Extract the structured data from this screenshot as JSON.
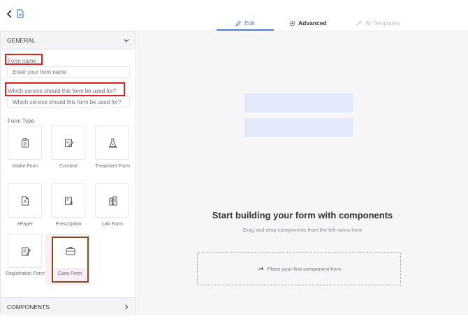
{
  "header": {
    "tabs": [
      {
        "label": "Edit",
        "icon": "pencil-icon",
        "active": true
      },
      {
        "label": "Advanced",
        "icon": "gear-icon",
        "active": false
      },
      {
        "label": "AI Templates",
        "icon": "sparkle-icon",
        "active": false
      }
    ]
  },
  "sidebar": {
    "general_title": "GENERAL",
    "form_name_label": "Form name",
    "form_name_placeholder": "Enter your form name",
    "service_label": "Which service should this form be used for?",
    "service_placeholder": "Which service should this form be used for?",
    "form_type_label": "Form Type",
    "form_types": [
      {
        "label": "Intake Form",
        "icon": "clipboard-icon"
      },
      {
        "label": "Consent",
        "icon": "signature-icon"
      },
      {
        "label": "Treatment Form",
        "icon": "treatment-icon"
      },
      {
        "label": "ePaper",
        "icon": "epaper-icon"
      },
      {
        "label": "Prescription",
        "icon": "prescription-icon"
      },
      {
        "label": "Lab Form",
        "icon": "lab-icon"
      },
      {
        "label": "Registration Form",
        "icon": "registration-icon"
      },
      {
        "label": "Case Form",
        "icon": "briefcase-icon"
      }
    ],
    "components_title": "COMPONENTS"
  },
  "canvas": {
    "heading": "Start building your form with components",
    "subheading": "Drag and drop components from the left menu here",
    "drop_text": "Place your first component here"
  },
  "colors": {
    "accent": "#4a7fd6",
    "highlight_red": "#e01e1e",
    "highlight_brown": "#8b4a1a",
    "placeholder_block": "#e2e9fb"
  }
}
